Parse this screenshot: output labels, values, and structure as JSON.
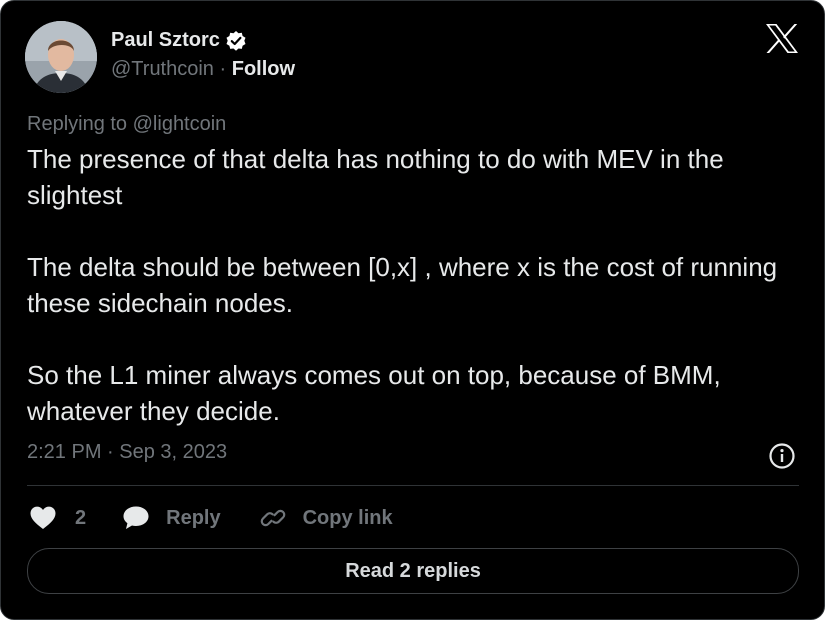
{
  "author": {
    "display_name": "Paul Sztorc",
    "handle": "@Truthcoin",
    "separator": "·",
    "follow_label": "Follow",
    "verified": true
  },
  "tweet": {
    "replying_prefix": "Replying to",
    "replying_to": "@lightcoin",
    "paragraphs": [
      "The presence of that delta has nothing to do with MEV in the slightest",
      "The delta should be between [0,x] , where x is the cost of running these sidechain nodes.",
      "So the L1 miner always comes out on top, because of BMM, whatever they decide."
    ],
    "timestamp": "2:21 PM · Sep 3, 2023"
  },
  "actions": {
    "like_count": "2",
    "reply_label": "Reply",
    "copy_label": "Copy link"
  },
  "read_replies_label": "Read 2 replies",
  "icons": {
    "brand": "x-logo-icon",
    "verified": "verified-badge-icon",
    "info": "info-icon",
    "like": "heart-icon",
    "reply": "speech-bubble-icon",
    "copy": "link-icon"
  },
  "colors": {
    "background": "#000000",
    "text_primary": "#e7e9ea",
    "text_secondary": "#71767b",
    "border": "#2f3336"
  }
}
